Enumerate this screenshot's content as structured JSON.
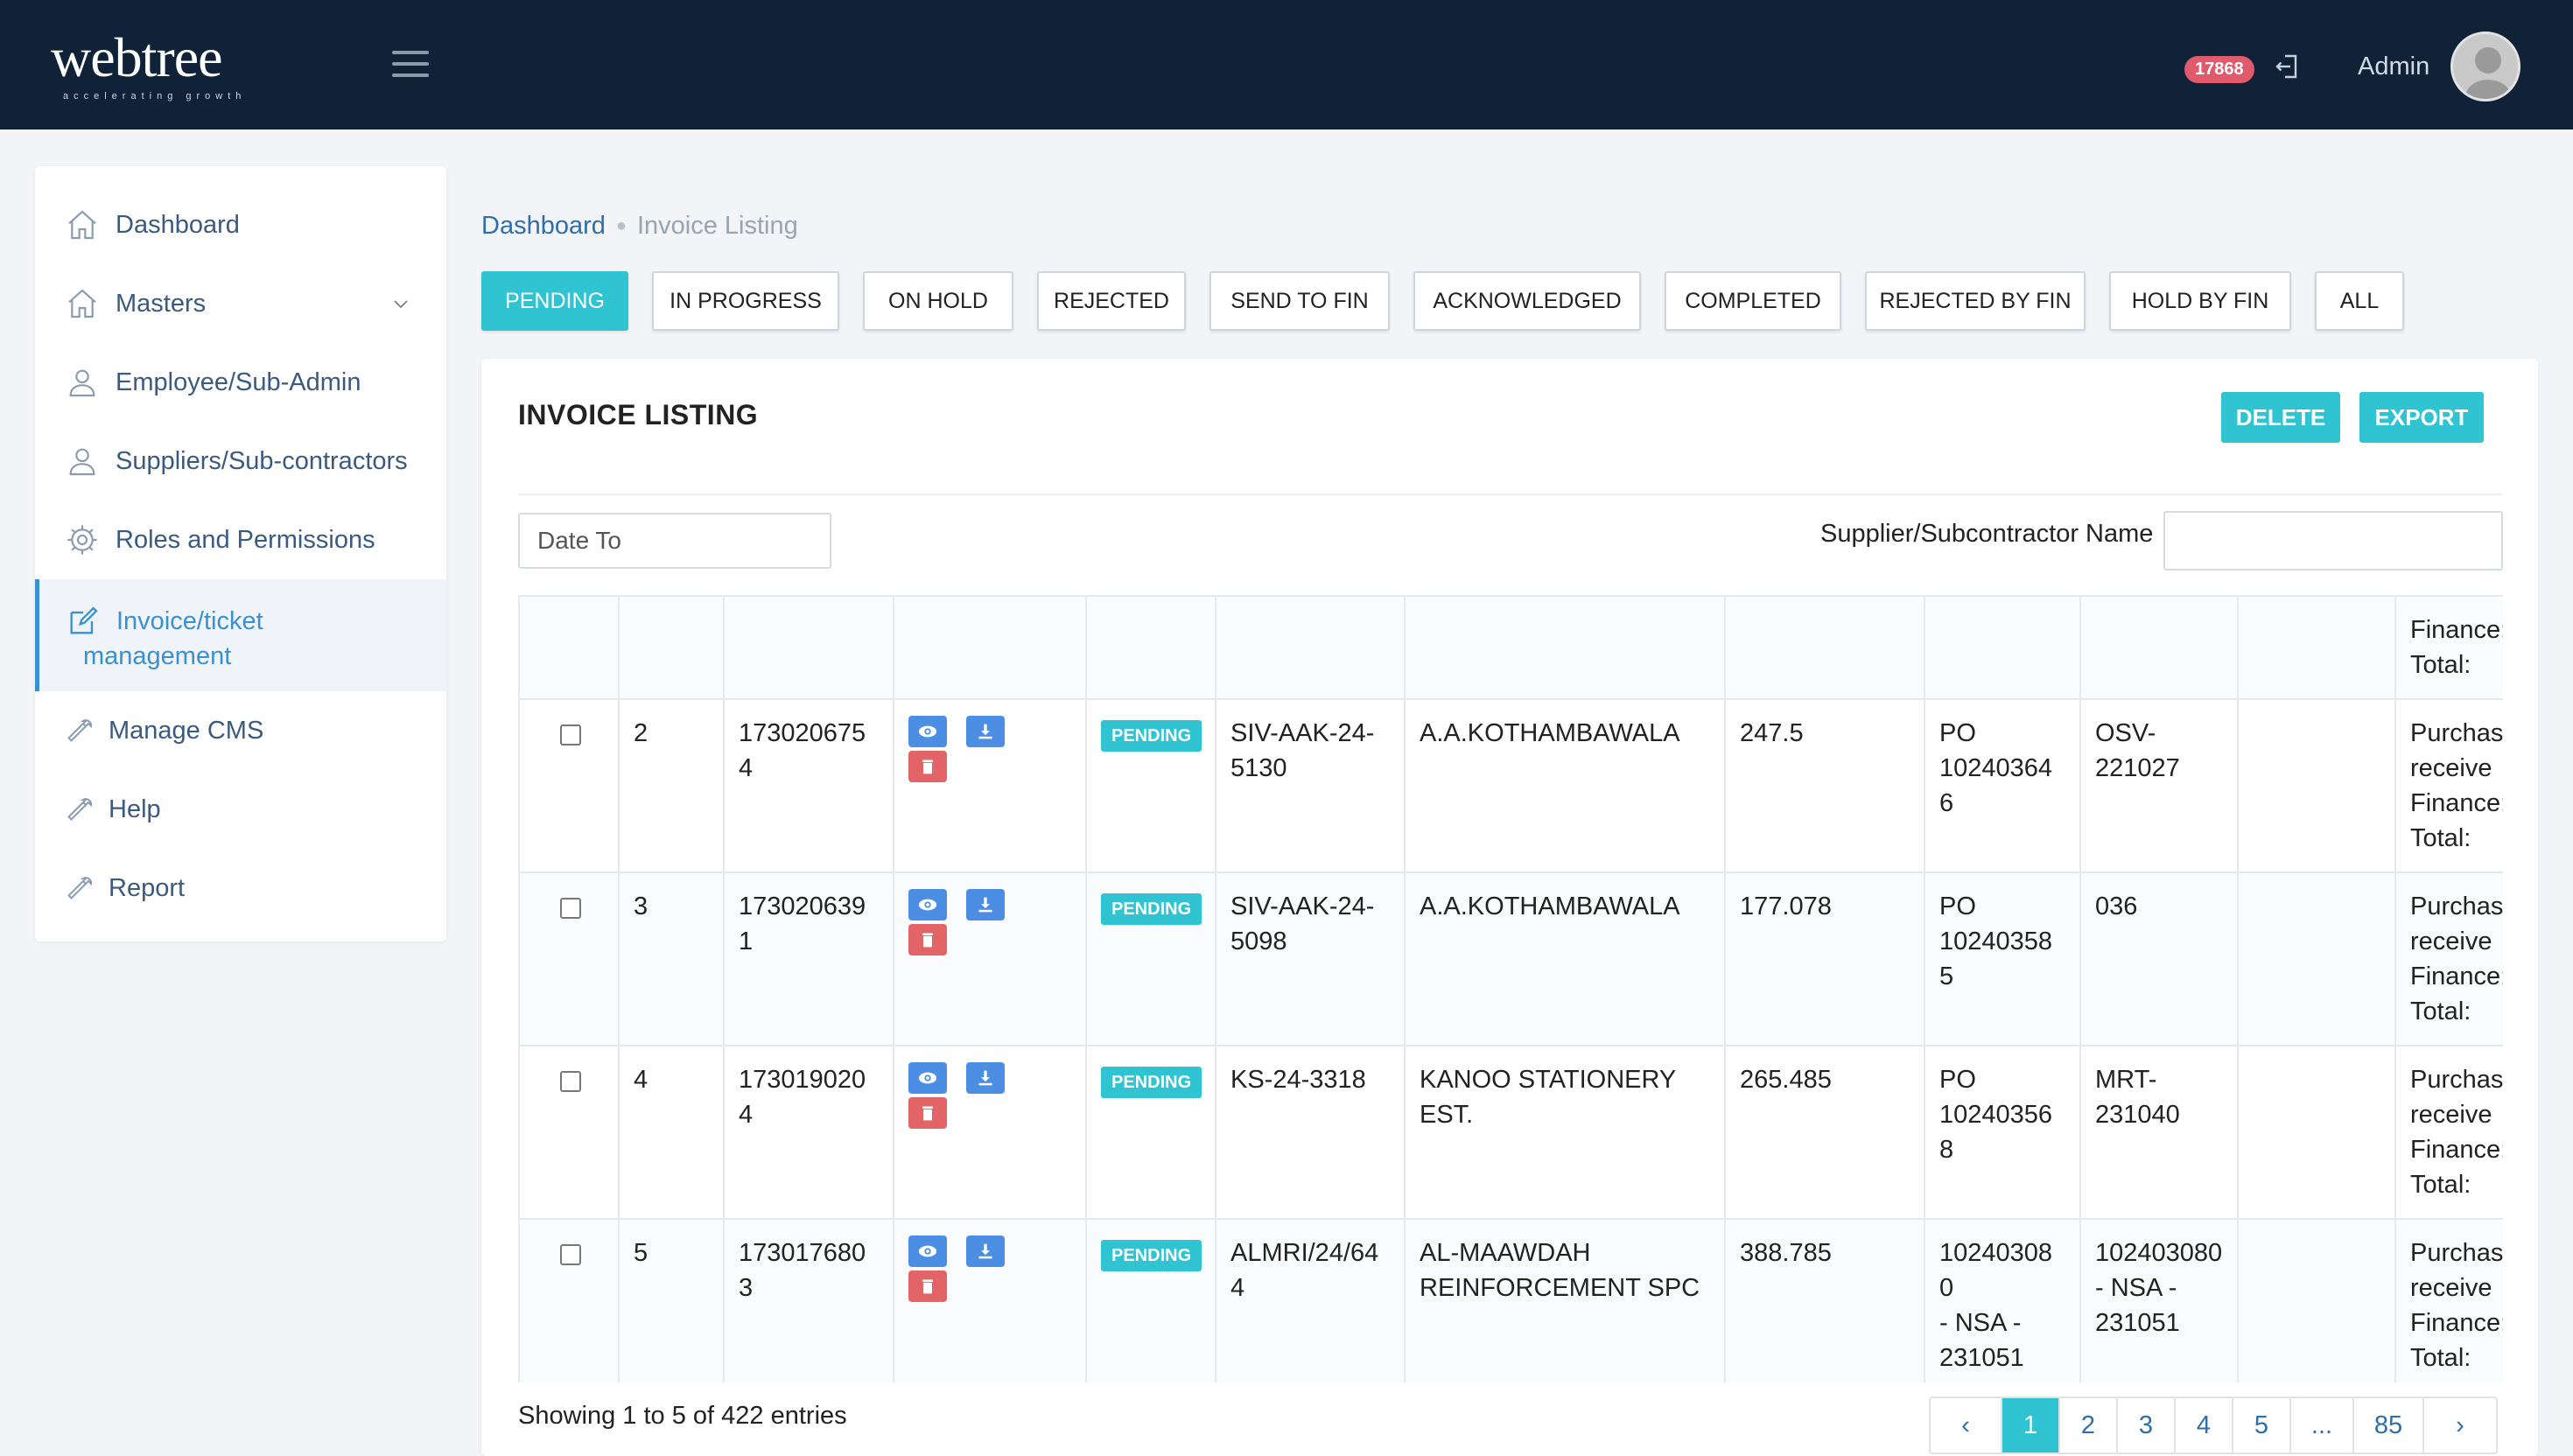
{
  "header": {
    "logo_text": "webtree",
    "logo_tagline": "accelerating growth",
    "notification_count": "17868",
    "user_name": "Admin"
  },
  "sidebar": {
    "items": [
      {
        "label": "Dashboard",
        "icon": "home-icon"
      },
      {
        "label": "Masters",
        "icon": "home-icon",
        "has_submenu": true
      },
      {
        "label": "Employee/Sub-Admin",
        "icon": "user-icon"
      },
      {
        "label": "Suppliers/Sub-contractors",
        "icon": "user-icon"
      },
      {
        "label": "Roles and Permissions",
        "icon": "gear-icon"
      },
      {
        "label_line1": "Invoice/ticket",
        "label_line2": "management",
        "icon": "edit-icon",
        "active": true
      },
      {
        "label": "Manage CMS",
        "icon": "wrench-icon"
      },
      {
        "label": "Help",
        "icon": "wrench-icon"
      },
      {
        "label": "Report",
        "icon": "wrench-icon"
      }
    ]
  },
  "breadcrumb": {
    "home": "Dashboard",
    "current": "Invoice Listing"
  },
  "status_tabs": [
    {
      "label": "PENDING",
      "active": true
    },
    {
      "label": "IN PROGRESS"
    },
    {
      "label": "ON HOLD"
    },
    {
      "label": "REJECTED"
    },
    {
      "label": "SEND TO FIN"
    },
    {
      "label": "ACKNOWLEDGED"
    },
    {
      "label": "COMPLETED"
    },
    {
      "label": "REJECTED BY FIN"
    },
    {
      "label": "HOLD BY FIN"
    },
    {
      "label": "ALL"
    }
  ],
  "listing": {
    "title": "INVOICE LISTING",
    "delete_label": "DELETE",
    "export_label": "EXPORT",
    "date_to_placeholder": "Date To",
    "supplier_filter_label": "Supplier/Subcontractor Name",
    "supplier_filter_value": ""
  },
  "table": {
    "partial_row": {
      "last_col_line1": "Finance:",
      "last_col_line2": "Total:"
    },
    "rows": [
      {
        "no": "2",
        "id": "1730206754",
        "status": "PENDING",
        "invoice_no_1": "SIV-AAK-24-",
        "invoice_no_2": "5130",
        "supplier": "A.A.KOTHAMBAWALA",
        "amount": "247.5",
        "po_1": "PO",
        "po_2": "102403646",
        "ref_1": "OSV-",
        "ref_2": "221027",
        "ref_3": "",
        "remarks_1": "Purchas",
        "remarks_2": "receive",
        "remarks_3": "Finance:",
        "remarks_4": "Total:"
      },
      {
        "no": "3",
        "id": "1730206391",
        "status": "PENDING",
        "invoice_no_1": "SIV-AAK-24-",
        "invoice_no_2": "5098",
        "supplier": "A.A.KOTHAMBAWALA",
        "amount": "177.078",
        "po_1": "PO",
        "po_2": "102403585",
        "ref_1": "036",
        "ref_2": "",
        "ref_3": "",
        "remarks_1": "Purchas",
        "remarks_2": "receive",
        "remarks_3": "Finance:",
        "remarks_4": "Total:"
      },
      {
        "no": "4",
        "id": "1730190204",
        "status": "PENDING",
        "invoice_no_1": "KS-24-3318",
        "invoice_no_2": "",
        "supplier": "KANOO STATIONERY EST.",
        "amount": "265.485",
        "po_1": "PO",
        "po_2": "102403568",
        "ref_1": "MRT-",
        "ref_2": "231040",
        "ref_3": "",
        "remarks_1": "Purchas",
        "remarks_2": "receive",
        "remarks_3": "Finance:",
        "remarks_4": "Total:"
      },
      {
        "no": "5",
        "id": "1730176803",
        "status": "PENDING",
        "invoice_no_1": "ALMRI/24/644",
        "invoice_no_2": "",
        "supplier": "AL-MAAWDAH REINFORCEMENT SPC",
        "amount": "388.785",
        "po_1": "102403080",
        "po_2": "- NSA -",
        "po_3": "231051",
        "ref_1": "102403080",
        "ref_2": "- NSA -",
        "ref_3": "231051",
        "remarks_1": "Purchas",
        "remarks_2": "receive",
        "remarks_3": "Finance:",
        "remarks_4": "Total:"
      }
    ]
  },
  "footer": {
    "showing": "Showing 1 to 5 of 422 entries",
    "pages": [
      "‹",
      "1",
      "2",
      "3",
      "4",
      "5",
      "...",
      "85",
      "›"
    ],
    "current_page": "1"
  },
  "colors": {
    "header_bg": "#0f2238",
    "accent": "#30c3d1",
    "link": "#2f6ea8",
    "badge_red": "#e05a6b"
  }
}
